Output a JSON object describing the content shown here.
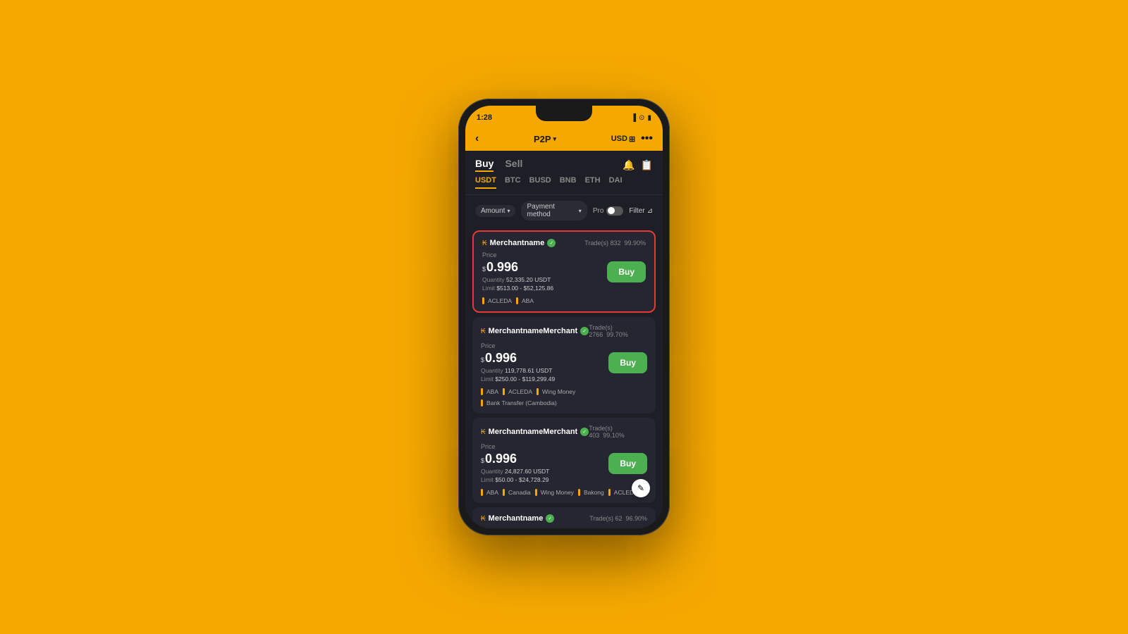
{
  "statusBar": {
    "time": "1:28",
    "icons": "▐ ▌ ))) ▮▮"
  },
  "topNav": {
    "back": "‹",
    "title": "P2P",
    "titleArrow": "▾",
    "currency": "USD",
    "currencyIcon": "⊞",
    "moreIcon": "•••"
  },
  "tabs": {
    "buy": "Buy",
    "sell": "Sell"
  },
  "cryptoTabs": [
    "USDT",
    "BTC",
    "BUSD",
    "BNB",
    "ETH",
    "DAI"
  ],
  "filters": {
    "amount": "Amount",
    "paymentMethod": "Payment method",
    "pro": "Pro",
    "filter": "Filter"
  },
  "listings": [
    {
      "merchantName": "Merchantname",
      "verified": true,
      "trades": "Trade(s) 832",
      "rate": "99.90%",
      "priceLabel": "Price",
      "priceCurrency": "$",
      "priceValue": "0.996",
      "quantityLabel": "Quantity",
      "quantity": "52,335.20 USDT",
      "limitLabel": "Limit",
      "limit": "$513.00 - $52,125.86",
      "buyLabel": "Buy",
      "tags": [
        "ACLEDA",
        "ABA"
      ],
      "highlighted": true
    },
    {
      "merchantName": "MerchantnameMerchant",
      "verified": true,
      "trades": "Trade(s) 2766",
      "rate": "99.70%",
      "priceLabel": "Price",
      "priceCurrency": "$",
      "priceValue": "0.996",
      "quantityLabel": "Quantity",
      "quantity": "119,778.61 USDT",
      "limitLabel": "Limit",
      "limit": "$250.00 - $119,299.49",
      "buyLabel": "Buy",
      "tags": [
        "ABA",
        "ACLEDA",
        "Wing Money",
        "Bank Transfer (Cambodia)"
      ],
      "highlighted": false
    },
    {
      "merchantName": "MerchantnameMerchant",
      "verified": true,
      "trades": "Trade(s) 403",
      "rate": "99.10%",
      "priceLabel": "Price",
      "priceCurrency": "$",
      "priceValue": "0.996",
      "quantityLabel": "Quantity",
      "quantity": "24,827.60 USDT",
      "limitLabel": "Limit",
      "limit": "$50.00 - $24,728.29",
      "buyLabel": "Buy",
      "tags": [
        "ABA",
        "Canadia",
        "Wing Money",
        "Bakong",
        "ACLEDA"
      ],
      "highlighted": false,
      "hasEditFab": true
    },
    {
      "merchantName": "Merchantname",
      "verified": true,
      "trades": "Trade(s) 62",
      "rate": "96.90%",
      "partial": true
    }
  ]
}
